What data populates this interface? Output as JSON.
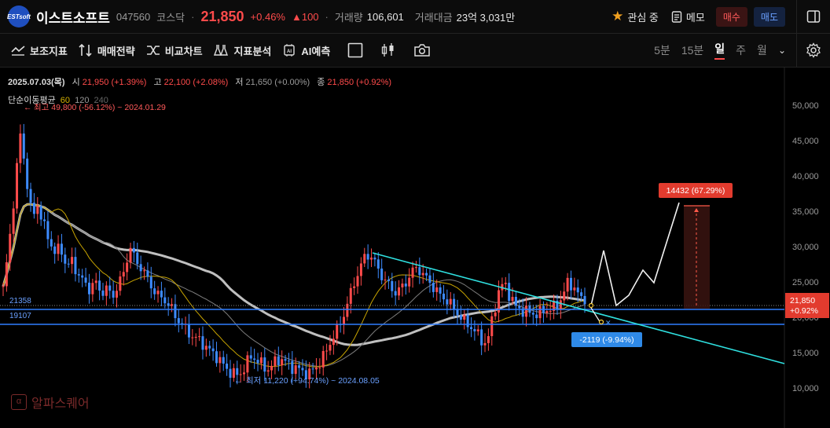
{
  "header": {
    "logo_text": "ESTsoft",
    "name": "이스트소프트",
    "code": "047560",
    "market": "코스닥",
    "price": "21,850",
    "change_pct": "+0.46%",
    "change_abs": "▲100",
    "volume_label": "거래량",
    "volume": "106,601",
    "amount_label": "거래대금",
    "amount": "23억 3,031만",
    "watch_label": "관심 중",
    "memo_label": "메모",
    "buy_label": "매수",
    "sell_label": "매도"
  },
  "toolbar": {
    "indicators": "보조지표",
    "strategy": "매매전략",
    "compare": "비교차트",
    "analysis": "지표분석",
    "ai": "AI예측",
    "periods": [
      "5분",
      "15분",
      "일",
      "주",
      "월"
    ],
    "active_period": "일"
  },
  "ohlc": {
    "date": "2025.07.03(목)",
    "open_label": "시",
    "open": "21,950 (+1.39%)",
    "high_label": "고",
    "high": "22,100 (+2.08%)",
    "low_label": "저",
    "low": "21,650 (+0.00%)",
    "close_label": "종",
    "close": "21,850 (+0.92%)"
  },
  "ma": {
    "label": "단순이동평균",
    "p1": "60",
    "p2": "120",
    "p3": "240"
  },
  "annotations": {
    "high_note": "최고 49,800 (-56.12%) ~ 2024.01.29",
    "low_note": "최저 11,220 (+94.74%) ~ 2024.08.05",
    "level_1": "21358",
    "level_2": "19107",
    "target_box": "14432 (67.29%)",
    "drop_box": "-2119 (-9.94%)",
    "price_tag_1": "21,850",
    "price_tag_2": "+0.92%"
  },
  "watermark": "알파스퀘어",
  "colors": {
    "up": "#ff4b4b",
    "down": "#3d8bff",
    "trend": "#2fe0e0",
    "ma60": "#c8a400",
    "ma120": "#7d7d7d",
    "ma240": "#bfbfbf",
    "level": "#2f7dff"
  },
  "chart_data": {
    "type": "candlestick",
    "y_axis_ticks": [
      50000,
      45000,
      40000,
      35000,
      30000,
      25000,
      20000,
      15000,
      10000
    ],
    "ylim": [
      9000,
      52000
    ],
    "close_series": [
      24000,
      30000,
      38000,
      46000,
      40000,
      34000,
      36000,
      33000,
      31000,
      29000,
      30000,
      27000,
      28000,
      26000,
      25000,
      24000,
      25000,
      23500,
      24000,
      23000,
      24500,
      26500,
      30000,
      28000,
      27000,
      25500,
      24000,
      23000,
      22500,
      21500,
      20000,
      19000,
      18000,
      17200,
      16800,
      16000,
      15200,
      14500,
      13500,
      12500,
      12000,
      11800,
      13000,
      14500,
      14000,
      13200,
      12600,
      13500,
      14200,
      13700,
      13000,
      12800,
      12300,
      12000,
      12600,
      13600,
      15000,
      16800,
      18200,
      20000,
      22500,
      25000,
      27000,
      29000,
      28500,
      27000,
      25500,
      24500,
      23500,
      24000,
      25000,
      26500,
      27000,
      26000,
      25000,
      24000,
      23000,
      22500,
      21500,
      20500,
      19500,
      18800,
      18000,
      16800,
      16200,
      20000,
      23500,
      25000,
      23000,
      21500,
      21000,
      20800,
      20500,
      20500,
      21000,
      21200,
      21500,
      22800,
      24800,
      24500,
      23000,
      21850
    ],
    "price_range": {
      "high": 49800,
      "high_date": "2024.01.29",
      "low": 11220,
      "low_date": "2024.08.05"
    },
    "support_levels": [
      21358,
      19107
    ],
    "last": {
      "open": 21950,
      "high": 22100,
      "low": 21650,
      "close": 21850
    }
  }
}
